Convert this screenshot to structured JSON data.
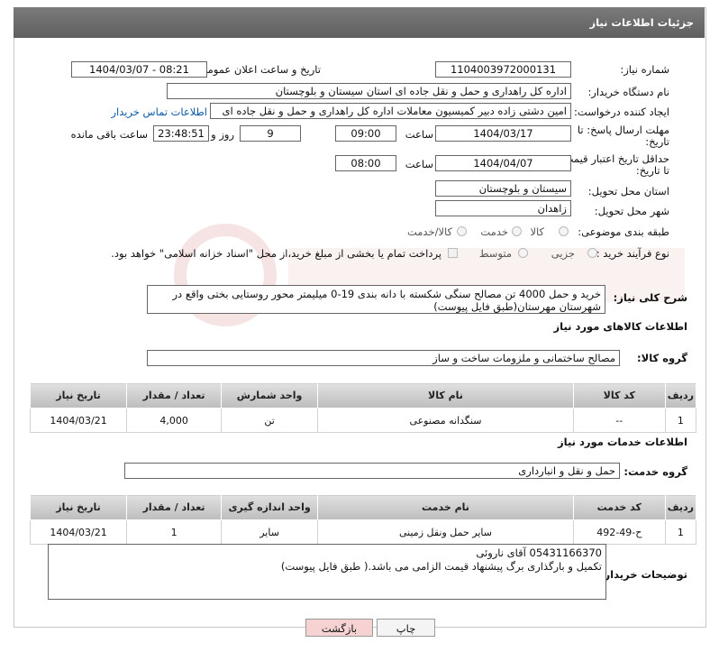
{
  "header": {
    "title": "جزئیات اطلاعات نیاز"
  },
  "fields": {
    "need_number_label": "شماره نیاز:",
    "need_number": "1104003972000131",
    "announce_label": "تاریخ و ساعت اعلان عمومی:",
    "announce_value": "1404/03/07 - 08:21",
    "buyer_org_label": "نام دستگاه خریدار:",
    "buyer_org": "اداره کل راهداری و حمل و نقل جاده ای استان سیستان و بلوچستان",
    "creator_label": "ایجاد کننده درخواست:",
    "creator": "امین دشتی زاده دبیر کمیسیون معاملات اداره کل راهداری و حمل و نقل جاده ای",
    "contact_link": "اطلاعات تماس خریدار",
    "deadline_label_1": "مهلت ارسال پاسخ: تا",
    "deadline_label_2": "تاریخ:",
    "deadline_date": "1404/03/17",
    "time_word": "ساعت",
    "deadline_time": "09:00",
    "days_value": "9",
    "days_word": "روز و",
    "remaining_time": "23:48:51",
    "remaining_word": "ساعت باقی مانده",
    "validity_label_1": "حداقل تاریخ اعتبار قیمت:",
    "validity_label_2": "تا تاریخ:",
    "validity_date": "1404/04/07",
    "validity_time": "08:00",
    "province_label": "استان محل تحویل:",
    "province": "سیستان و بلوچستان",
    "city_label": "شهر محل تحویل:",
    "city": "زاهدان",
    "category_label": "طبقه بندی موضوعی:",
    "category_options": [
      "کالا",
      "خدمت",
      "کالا/خدمت"
    ],
    "process_label": "نوع فرآیند خرید :",
    "process_options": [
      "جزیی",
      "متوسط"
    ],
    "payment_note": "پرداخت تمام یا بخشی از مبلغ خرید،از محل \"اسناد خزانه اسلامی\" خواهد بود."
  },
  "description": {
    "label": "شرح کلی نیاز:",
    "text": "خرید و حمل 4000 تن مصالح سنگی شکسته با دانه بندی 19-0 میلیمتر محور روستایی بختی واقع در شهرستان مهرستان(طبق فایل پیوست)"
  },
  "goods": {
    "section_title": "اطلاعات کالاهای مورد نیاز",
    "group_label": "گروه کالا:",
    "group_value": "مصالح ساختمانی و ملزومات ساخت و ساز",
    "columns": [
      "ردیف",
      "کد کالا",
      "نام کالا",
      "واحد شمارش",
      "تعداد / مقدار",
      "تاریخ نیاز"
    ],
    "rows": [
      [
        "1",
        "--",
        "سنگدانه مصنوعی",
        "تن",
        "4,000",
        "1404/03/21"
      ]
    ]
  },
  "services": {
    "section_title": "اطلاعات خدمات مورد نیاز",
    "group_label": "گروه خدمت:",
    "group_value": "حمل و نقل و انبارداری",
    "columns": [
      "ردیف",
      "کد خدمت",
      "نام خدمت",
      "واحد اندازه گیری",
      "تعداد / مقدار",
      "تاریخ نیاز"
    ],
    "rows": [
      [
        "1",
        "ح-49-492",
        "سایر حمل ونقل زمینی",
        "سایر",
        "1",
        "1404/03/21"
      ]
    ]
  },
  "buyer_notes": {
    "label": "توضیحات خریدار:",
    "line1": "05431166370 آقای ناروئی",
    "line2": "تکمیل و بارگذاری برگ پیشنهاد قیمت الزامی می باشد.( طبق فایل پیوست)"
  },
  "buttons": {
    "back": "بازگشت",
    "print": "چاپ"
  },
  "colors": {
    "header_bg": "#6b6b6b",
    "back_button_bg": "#f6d2d2",
    "print_button_bg": "#f4f4f4",
    "link": "#0a58a8"
  }
}
